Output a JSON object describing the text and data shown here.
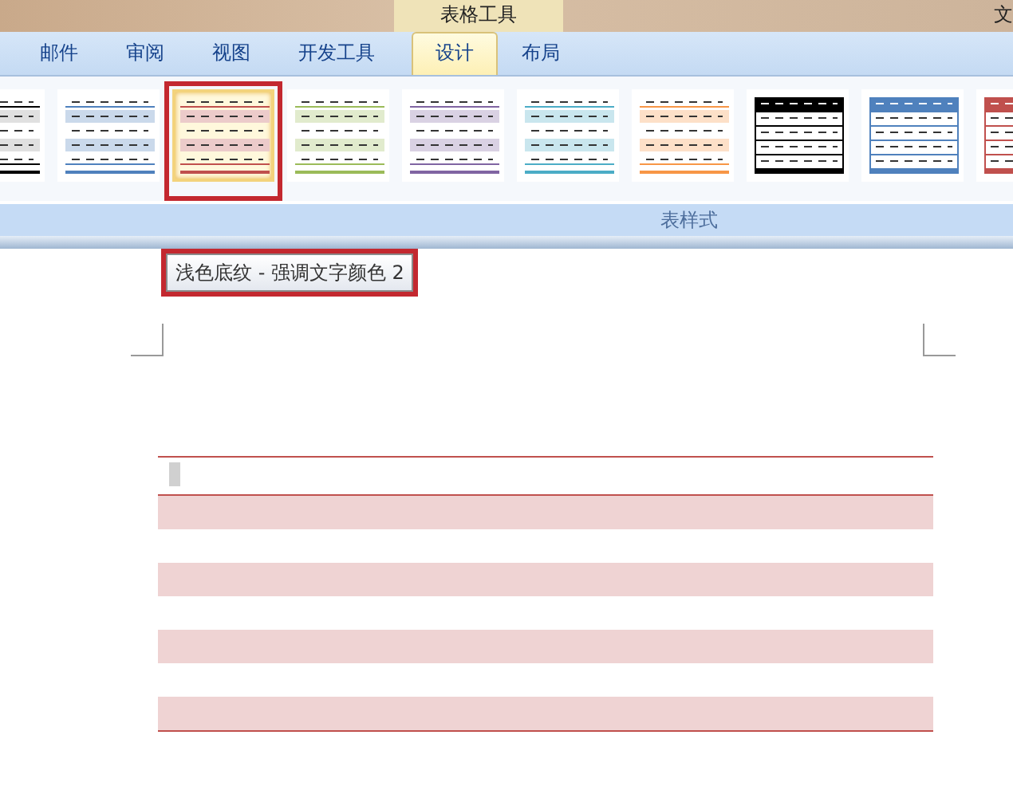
{
  "title_bar": {
    "context_group": "表格工具",
    "window_title": "文"
  },
  "tabs": [
    {
      "label": "邮件",
      "selected": false
    },
    {
      "label": "审阅",
      "selected": false
    },
    {
      "label": "视图",
      "selected": false
    },
    {
      "label": "开发工具",
      "selected": false
    },
    {
      "label": "设计",
      "selected": true
    },
    {
      "label": "布局",
      "selected": false
    }
  ],
  "table_styles": [
    {
      "kind": "shading",
      "color": "#000000",
      "selected": false,
      "highlighted": false
    },
    {
      "kind": "shading",
      "color": "#4f81bd",
      "selected": false,
      "highlighted": false
    },
    {
      "kind": "shading",
      "color": "#c0504d",
      "selected": true,
      "highlighted": true
    },
    {
      "kind": "shading",
      "color": "#9bbb59",
      "selected": false,
      "highlighted": false
    },
    {
      "kind": "shading",
      "color": "#8064a2",
      "selected": false,
      "highlighted": false
    },
    {
      "kind": "shading",
      "color": "#4bacc6",
      "selected": false,
      "highlighted": false
    },
    {
      "kind": "shading",
      "color": "#f79646",
      "selected": false,
      "highlighted": false
    },
    {
      "kind": "grid",
      "color": "#000000",
      "selected": false,
      "highlighted": false
    },
    {
      "kind": "grid",
      "color": "#4f81bd",
      "selected": false,
      "highlighted": false
    },
    {
      "kind": "grid",
      "color": "#c0504d",
      "selected": false,
      "highlighted": false
    }
  ],
  "group_label": "表样式",
  "tooltip": {
    "text": "浅色底纹 - 强调文字颜色 2",
    "highlighted": true
  },
  "table": {
    "color": "#c0504d",
    "rows": [
      {
        "shaded": false
      },
      {
        "shaded": true
      },
      {
        "shaded": false
      },
      {
        "shaded": true
      },
      {
        "shaded": false
      },
      {
        "shaded": true
      },
      {
        "shaded": false
      },
      {
        "shaded": true
      }
    ]
  }
}
